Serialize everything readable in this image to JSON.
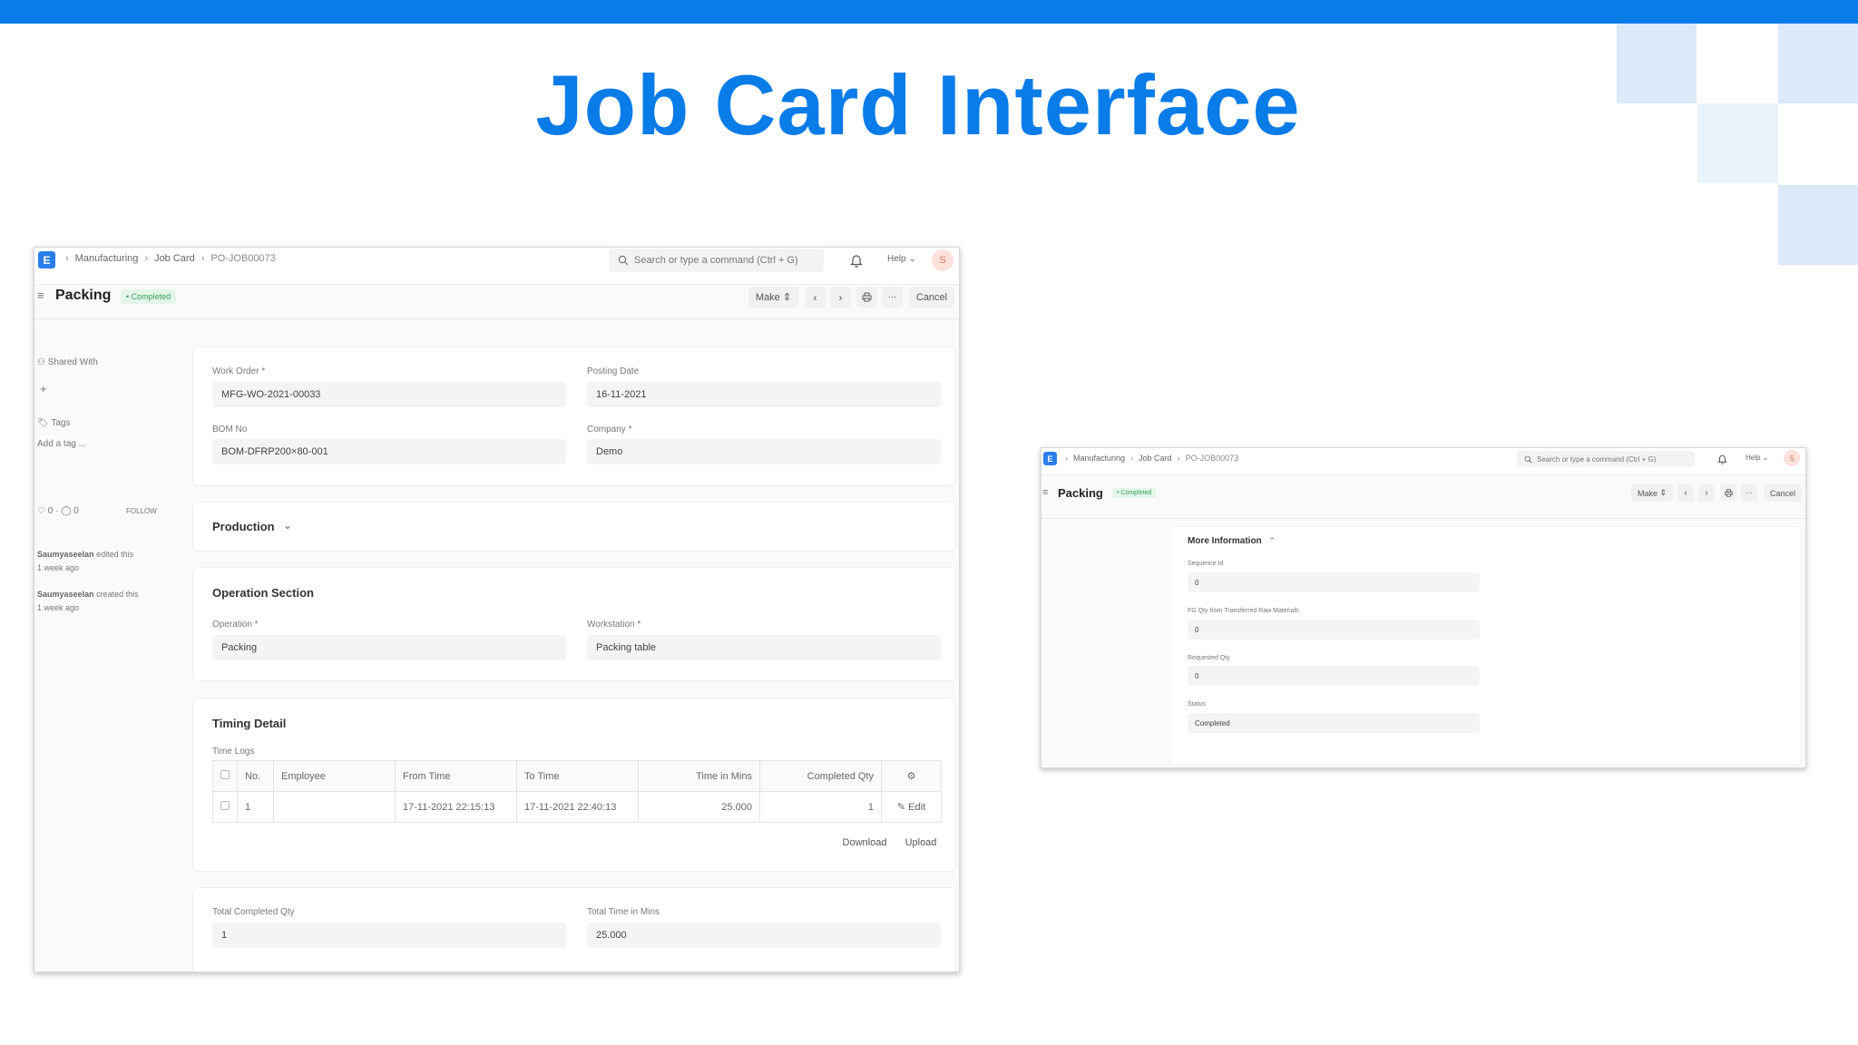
{
  "slide": {
    "title": "Job Card Interface"
  },
  "app": {
    "logo_letter": "E",
    "breadcrumbs": [
      "Manufacturing",
      "Job Card",
      "PO-JOB00073"
    ],
    "breadcrumbs_small": [
      "Manufacturing",
      "Job Card",
      "PO-JOB00073"
    ],
    "search_placeholder": "Search or type a command (Ctrl + G)",
    "search_placeholder_small": "Search or type a command (Ctrl + G)",
    "help_label": "Help",
    "avatar_letter": "S"
  },
  "page": {
    "title": "Packing",
    "status": "Completed",
    "make_label": "Make",
    "cancel_label": "Cancel"
  },
  "sidebar": {
    "shared_with_label": "Shared With",
    "tags_label": "Tags",
    "add_tag_label": "Add a tag ...",
    "likes": "0",
    "comments": "0",
    "follow_label": "FOLLOW",
    "activity": [
      {
        "user": "Saumyaseelan",
        "action": "edited this",
        "time": "1 week ago"
      },
      {
        "user": "Saumyaseelan",
        "action": "created this",
        "time": "1 week ago"
      }
    ]
  },
  "form": {
    "work_order": {
      "label": "Work Order *",
      "value": "MFG-WO-2021-00033"
    },
    "posting_date": {
      "label": "Posting Date",
      "value": "16-11-2021"
    },
    "bom_no": {
      "label": "BOM No",
      "value": "BOM-DFRP200×80-001"
    },
    "company": {
      "label": "Company *",
      "value": "Demo"
    },
    "production_section": "Production",
    "operation_section": "Operation Section",
    "operation": {
      "label": "Operation *",
      "value": "Packing"
    },
    "workstation": {
      "label": "Workstation *",
      "value": "Packing table"
    },
    "timing_section": "Timing Detail",
    "time_logs_label": "Time Logs",
    "time_logs": {
      "headers": [
        "No.",
        "Employee",
        "From Time",
        "To Time",
        "Time in Mins",
        "Completed Qty"
      ],
      "rows": [
        {
          "no": "1",
          "employee": "",
          "from": "17-11-2021 22:15:13",
          "to": "17-11-2021 22:40:13",
          "mins": "25.000",
          "qty": "1",
          "edit": "Edit"
        }
      ]
    },
    "download_label": "Download",
    "upload_label": "Upload",
    "total_completed_qty": {
      "label": "Total Completed Qty",
      "value": "1"
    },
    "total_time": {
      "label": "Total Time in Mins",
      "value": "25.000"
    }
  },
  "more_info": {
    "section_title": "More Information",
    "sequence_id": {
      "label": "Sequence Id",
      "value": "0"
    },
    "fg_qty": {
      "label": "FG Qty from Transferred Raw Materials",
      "value": "0"
    },
    "requested_qty": {
      "label": "Requested Qty",
      "value": "0"
    },
    "status": {
      "label": "Status",
      "value": "Completed"
    }
  },
  "colors": {
    "accent": "#0a7ce8",
    "logo": "#2b7de9",
    "badge_green": "#35a05a",
    "deco": "#dbe9f9"
  }
}
